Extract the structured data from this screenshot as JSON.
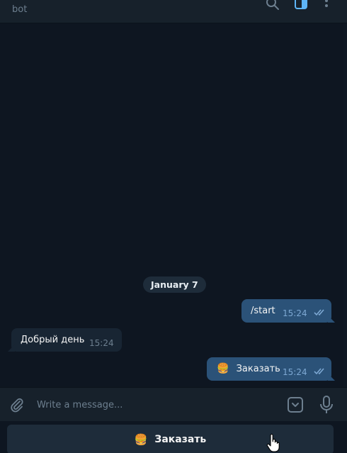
{
  "header": {
    "subtitle": "bot",
    "icons": [
      "search-icon",
      "sidebar-toggle-icon",
      "more-vertical-icon"
    ],
    "accent": "#5eb5f7"
  },
  "chat": {
    "date_separator": "January 7",
    "messages": [
      {
        "direction": "out",
        "text": "/start",
        "time": "15:24",
        "status": "read"
      },
      {
        "direction": "in",
        "text": "Добрый день",
        "time": "15:24"
      },
      {
        "direction": "out",
        "emoji": "🍔",
        "text": "Заказать",
        "time": "15:24",
        "status": "read"
      }
    ]
  },
  "composer": {
    "placeholder": "Write a message...",
    "icons": [
      "attach-icon",
      "bot-keyboard-icon",
      "microphone-icon"
    ]
  },
  "keyboard": {
    "button_emoji": "🍔",
    "button_label": "Заказать"
  },
  "colors": {
    "background": "#0e1621",
    "panel": "#17212b",
    "outgoing_bubble": "#2b5278",
    "incoming_bubble": "#182533",
    "muted_text": "#6d7f8f"
  }
}
